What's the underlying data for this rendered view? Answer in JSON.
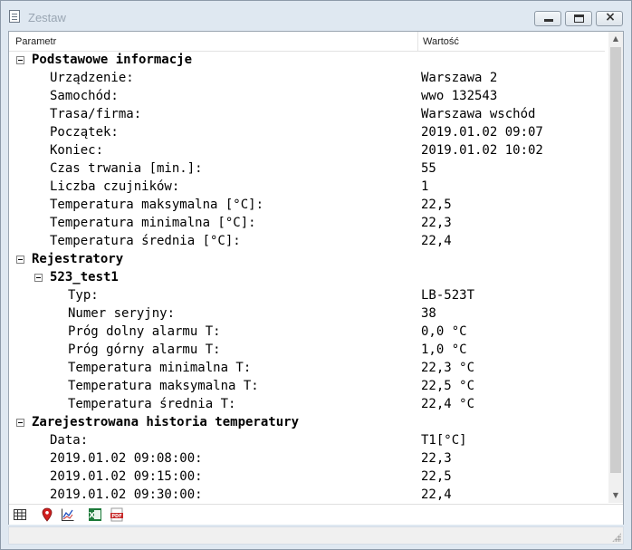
{
  "window": {
    "title": "Zestaw"
  },
  "columns": {
    "parameter": "Parametr",
    "value": "Wartość"
  },
  "rows": [
    {
      "level": 0,
      "group": true,
      "label": "Podstawowe informacje",
      "value": ""
    },
    {
      "level": 1,
      "group": false,
      "label": "Urządzenie:",
      "value": "Warszawa 2"
    },
    {
      "level": 1,
      "group": false,
      "label": "Samochód:",
      "value": "wwo 132543"
    },
    {
      "level": 1,
      "group": false,
      "label": "Trasa/firma:",
      "value": "Warszawa wschód"
    },
    {
      "level": 1,
      "group": false,
      "label": "Początek:",
      "value": "2019.01.02 09:07"
    },
    {
      "level": 1,
      "group": false,
      "label": "Koniec:",
      "value": "2019.01.02 10:02"
    },
    {
      "level": 1,
      "group": false,
      "label": "Czas trwania [min.]:",
      "value": "55"
    },
    {
      "level": 1,
      "group": false,
      "label": "Liczba czujników:",
      "value": "1"
    },
    {
      "level": 1,
      "group": false,
      "label": "Temperatura maksymalna [°C]:",
      "value": "22,5"
    },
    {
      "level": 1,
      "group": false,
      "label": "Temperatura minimalna [°C]:",
      "value": "22,3"
    },
    {
      "level": 1,
      "group": false,
      "label": "Temperatura średnia [°C]:",
      "value": "22,4"
    },
    {
      "level": 0,
      "group": true,
      "label": "Rejestratory",
      "value": ""
    },
    {
      "level": 1,
      "group": true,
      "label": "523_test1",
      "value": ""
    },
    {
      "level": 2,
      "group": false,
      "label": "Typ:",
      "value": "LB-523T"
    },
    {
      "level": 2,
      "group": false,
      "label": "Numer seryjny:",
      "value": "38"
    },
    {
      "level": 2,
      "group": false,
      "label": "Próg dolny alarmu T:",
      "value": "0,0 °C"
    },
    {
      "level": 2,
      "group": false,
      "label": "Próg górny alarmu T:",
      "value": "1,0 °C"
    },
    {
      "level": 2,
      "group": false,
      "label": "Temperatura minimalna T:",
      "value": "22,3 °C"
    },
    {
      "level": 2,
      "group": false,
      "label": "Temperatura maksymalna T:",
      "value": "22,5 °C"
    },
    {
      "level": 2,
      "group": false,
      "label": "Temperatura średnia T:",
      "value": "22,4 °C"
    },
    {
      "level": 0,
      "group": true,
      "label": "Zarejestrowana historia temperatury",
      "value": ""
    },
    {
      "level": 1,
      "group": false,
      "label": "Data:",
      "value": "T1[°C]"
    },
    {
      "level": 1,
      "group": false,
      "label": "2019.01.02 09:08:00:",
      "value": "22,3"
    },
    {
      "level": 1,
      "group": false,
      "label": "2019.01.02 09:15:00:",
      "value": "22,5"
    },
    {
      "level": 1,
      "group": false,
      "label": "2019.01.02 09:30:00:",
      "value": "22,4"
    }
  ],
  "toolbar": [
    {
      "name": "table-view-icon"
    },
    {
      "name": "map-pin-icon"
    },
    {
      "name": "chart-icon"
    },
    {
      "name": "excel-export-icon"
    },
    {
      "name": "pdf-export-icon"
    }
  ],
  "colors": {
    "window_bg": "#dfe8f1",
    "map_pin": "#d11f1f",
    "excel_green": "#1d7a3a",
    "pdf_red": "#c62828"
  }
}
